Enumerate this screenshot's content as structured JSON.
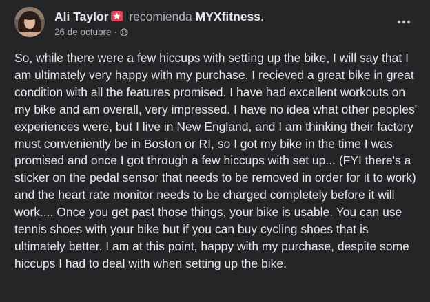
{
  "post": {
    "author": "Ali Taylor",
    "verb": "recomienda",
    "page": "MYXfitness",
    "period": ".",
    "date": "26 de octubre",
    "separator": "·",
    "privacy_icon": "globe-icon",
    "menu_icon": "more-options-icon",
    "badge_icon": "star-badge-icon",
    "body": "So, while there were a few hiccups with setting up the bike, I will say that I am ultimately very happy with my purchase. I recieved a great bike in great condition with all the features promised. I have had excellent workouts on my bike and am overall, very impressed. I have no idea what other peoples' experiences were, but I live in New England, and I am thinking their factory must conveniently be in Boston or RI, so I got my bike in the time I was promised and once I got through a few hiccups with set up... (FYI there's a sticker on the pedal sensor that needs to be removed in order for it to work) and the heart rate monitor needs to be charged completely before it will work.... Once you get past those things, your bike is usable. You can use tennis shoes with your bike but if you can buy cycling shoes that is ultimately better. I am at this point, happy with my purchase, despite some hiccups I had to deal with when setting up the bike."
  },
  "colors": {
    "background": "#242526",
    "text_primary": "#e4e6eb",
    "text_secondary": "#b0b3b8",
    "badge": "#e8435c"
  }
}
